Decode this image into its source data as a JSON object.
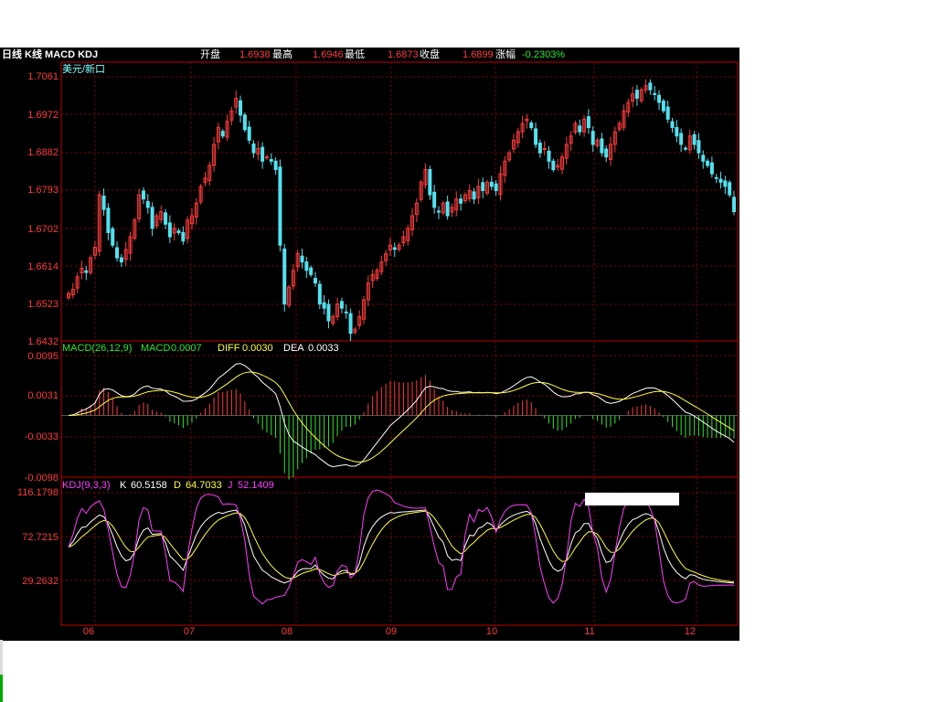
{
  "header": {
    "title": "日线 K线 MACD KDJ",
    "open_label": "开盘",
    "open_value": "1.6938",
    "high_label": "最高",
    "high_value": "1.6946",
    "low_label": "最低",
    "low_value": "1.6873",
    "close_label": "收盘",
    "close_value": "1.6899",
    "change_label": "涨幅",
    "change_value": "-0.2303%"
  },
  "colors": {
    "up": "#ff3b3b",
    "down": "#53e2f0",
    "grid": "#8a0000",
    "axis": "#c00000"
  },
  "chart_data": [
    {
      "type": "candlestick",
      "title": "美元/新口",
      "y_ticks": [
        "1.7061",
        "1.6972",
        "1.6882",
        "1.6793",
        "1.6702",
        "1.6614",
        "1.6523",
        "1.6432"
      ],
      "ylim": [
        1.6432,
        1.7061
      ],
      "x_ticks": [
        "06",
        "07",
        "08",
        "09",
        "10",
        "11",
        "12"
      ],
      "grid": true,
      "closes": [
        1.6545,
        1.6555,
        1.6585,
        1.6605,
        1.6595,
        1.663,
        1.6655,
        1.678,
        1.6745,
        1.669,
        1.666,
        1.663,
        1.662,
        1.665,
        1.668,
        1.672,
        1.678,
        1.677,
        1.675,
        1.67,
        1.673,
        1.674,
        1.671,
        1.668,
        1.67,
        1.669,
        1.667,
        1.672,
        1.673,
        1.676,
        1.68,
        1.682,
        1.685,
        1.69,
        1.694,
        1.692,
        1.6955,
        1.698,
        1.701,
        1.697,
        1.6935,
        1.691,
        1.688,
        1.689,
        1.686,
        1.687,
        1.686,
        1.684,
        1.666,
        1.652,
        1.656,
        1.66,
        1.664,
        1.662,
        1.66,
        1.659,
        1.657,
        1.652,
        1.651,
        1.648,
        1.649,
        1.652,
        1.651,
        1.65,
        1.645,
        1.646,
        1.649,
        1.653,
        1.657,
        1.659,
        1.66,
        1.662,
        1.664,
        1.666,
        1.665,
        1.666,
        1.668,
        1.67,
        1.673,
        1.676,
        1.681,
        1.684,
        1.678,
        1.675,
        1.674,
        1.676,
        1.673,
        1.675,
        1.677,
        1.676,
        1.678,
        1.679,
        1.677,
        1.68,
        1.679,
        1.681,
        1.68,
        1.679,
        1.683,
        1.686,
        1.688,
        1.691,
        1.693,
        1.695,
        1.696,
        1.694,
        1.69,
        1.688,
        1.689,
        1.686,
        1.684,
        1.685,
        1.687,
        1.69,
        1.692,
        1.695,
        1.693,
        1.696,
        1.694,
        1.69,
        1.691,
        1.688,
        1.687,
        1.69,
        1.693,
        1.695,
        1.698,
        1.7,
        1.702,
        1.701,
        1.703,
        1.704,
        1.703,
        1.702,
        1.7,
        1.698,
        1.696,
        1.694,
        1.692,
        1.69,
        1.689,
        1.692,
        1.69,
        1.688,
        1.686,
        1.685,
        1.683,
        1.682,
        1.681,
        1.68,
        1.678,
        1.674
      ]
    },
    {
      "type": "line",
      "title": "MACD(26,12,9)",
      "series": [
        {
          "name": "MACD",
          "value_text": "0.0007",
          "color": "#2ee82e"
        },
        {
          "name": "DIFF",
          "value_text": "0.0030",
          "color": "#ffff3c"
        },
        {
          "name": "DEA",
          "value_text": "0.0033",
          "color": "#ffffff"
        }
      ],
      "y_ticks": [
        "0.0095",
        "0.0031",
        "-0.0033",
        "-0.0098"
      ],
      "ylim": [
        -0.0098,
        0.0095
      ]
    },
    {
      "type": "line",
      "title": "KDJ(9,3,3)",
      "series": [
        {
          "name": "K",
          "value_text": "60.5158",
          "color": "#ffffff"
        },
        {
          "name": "D",
          "value_text": "64.7033",
          "color": "#ffff3c"
        },
        {
          "name": "J",
          "value_text": "52.1409",
          "color": "#ff3cff"
        }
      ],
      "y_ticks": [
        "116.1798",
        "72.7215",
        "29.2632"
      ],
      "ylim": [
        0,
        120
      ]
    }
  ]
}
